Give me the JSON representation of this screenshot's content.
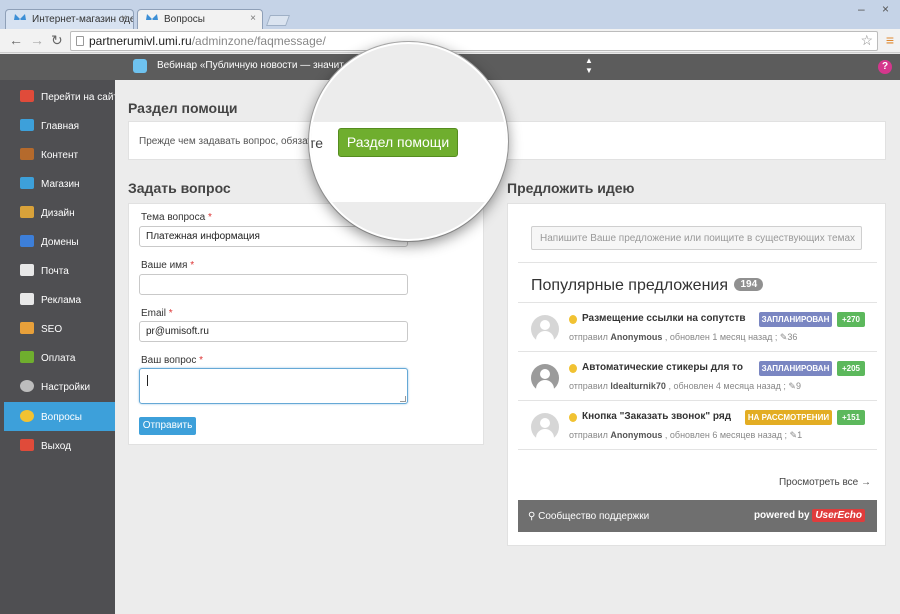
{
  "browser": {
    "tabs": [
      {
        "title": "Интернет-магазин одеж"
      },
      {
        "title": "Вопросы"
      }
    ],
    "tab_close": "×",
    "url_host": "partnerumivl.umi.ru",
    "url_path": "/adminzone/faqmessage/",
    "win_minimize": "–",
    "win_close": "×"
  },
  "topbar": {
    "news": "Вебинар «Публичную новости — значит, существо",
    "help_label": "?"
  },
  "sidebar": {
    "items": [
      {
        "label": "Перейти на сайт",
        "icon": "home-icon",
        "color": "#e04b3a"
      },
      {
        "label": "Главная",
        "icon": "butterfly-icon",
        "color": "#3da0da"
      },
      {
        "label": "Контент",
        "icon": "document-icon",
        "color": "#b56a2c"
      },
      {
        "label": "Магазин",
        "icon": "cart-icon",
        "color": "#3da0da"
      },
      {
        "label": "Дизайн",
        "icon": "palette-icon",
        "color": "#d9a23a"
      },
      {
        "label": "Домены",
        "icon": "domain-icon",
        "color": "#3d7fd9"
      },
      {
        "label": "Почта",
        "icon": "mail-icon",
        "color": "#e8e8e8"
      },
      {
        "label": "Реклама",
        "icon": "megaphone-icon",
        "color": "#e8e8e8"
      },
      {
        "label": "SEO",
        "icon": "bar-chart-icon",
        "color": "#e8a03a"
      },
      {
        "label": "Оплата",
        "icon": "money-icon",
        "color": "#6fae2e"
      },
      {
        "label": "Настройки",
        "icon": "gear-icon",
        "color": "#bdbdbd"
      },
      {
        "label": "Вопросы",
        "icon": "question-icon",
        "color": "#f1c232"
      },
      {
        "label": "Выход",
        "icon": "exit-icon",
        "color": "#e04b3a"
      }
    ],
    "active_index": 11
  },
  "help_section": {
    "title": "Раздел помощи",
    "text": "Прежде чем задавать вопрос, обязательно"
  },
  "magnifier": {
    "text": "те",
    "button": "Раздел помощи"
  },
  "ask_form": {
    "title": "Задать вопрос",
    "required_mark": "*",
    "topic_label": "Тема вопроса",
    "topic_value": "Платежная информация",
    "name_label": "Ваше имя",
    "name_value": "",
    "email_label": "Email",
    "email_value": "pr@umisoft.ru",
    "question_label": "Ваш вопрос",
    "question_value": "",
    "submit_label": "Отправить"
  },
  "idea": {
    "title": "Предложить идею",
    "search_placeholder": "Напишите Ваше предложение или поищите в существующих темах",
    "popular_title": "Популярные предложения",
    "popular_count": "194",
    "suggestions": [
      {
        "title": "Размещение ссылки на сопутств",
        "meta_prefix": "отправил",
        "author": "Anonymous",
        "updated": ", обновлен 1 месяц назад ;",
        "comments": "36",
        "status": "ЗАПЛАНИРОВАН",
        "status_type": "planned",
        "votes": "+270"
      },
      {
        "title": "Автоматические стикеры для то",
        "meta_prefix": "отправил",
        "author": "ldealturnik70",
        "updated": ", обновлен 4 месяца назад ;",
        "comments": "9",
        "status": "ЗАПЛАНИРОВАН",
        "status_type": "planned",
        "votes": "+205"
      },
      {
        "title": "Кнопка \"Заказать звонок\" ряд",
        "meta_prefix": "отправил",
        "author": "Anonymous",
        "updated": ", обновлен 6 месяцев назад ;",
        "comments": "1",
        "status": "НА РАССМОТРЕНИИ",
        "status_type": "review",
        "votes": "+151"
      }
    ],
    "view_all": "Просмотреть все →",
    "community": "Сообщество поддержки",
    "powered_by": "powered by",
    "brand": "UserEcho"
  }
}
